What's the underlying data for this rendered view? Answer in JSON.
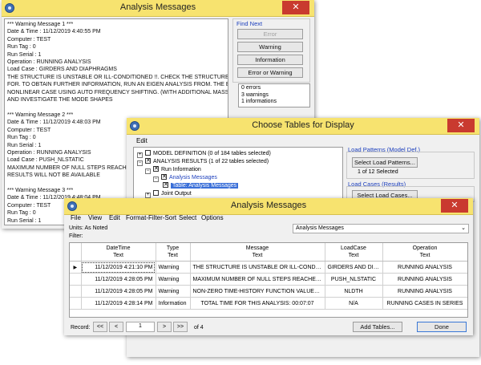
{
  "analysis_window": {
    "title": "Analysis Messages",
    "messages_text": "*** Warning Message 1 ***\nDate & Time : 11/12/2019 4:40:55 PM\nComputer : TEST\nRun Tag : 0\nRun Serial : 1\nOperation : RUNNING ANALYSIS\nLoad Case : GIRDERS AND DIAPHRAGMS\nTHE STRUCTURE IS UNSTABLE OR ILL-CONDITIONED !!. CHECK THE STRUCTURE CAREFULLY\nFOR. TO OBTAIN FURTHER INFORMATION, RUN AN EIGEN ANALYSIS FROM. THE END OF THIS\nNONLINEAR CASE USING AUTO FREQUENCY SHIFTING. (WITH ADDITIONAL MASS IF NEEDED)\nAND INVESTIGATE THE MODE SHAPES\n\n*** Warning Message 2 ***\nDate & Time : 11/12/2019 4:48:03 PM\nComputer : TEST\nRun Tag : 0\nRun Serial : 1\nOperation : RUNNING ANALYSIS\nLoad Case : PUSH_NLSTATIC\nMAXIMUM NUMBER OF NULL STEPS REACHED FOR. C\nRESULTS WILL NOT BE AVAILABLE\n\n*** Warning Message 3 ***\nDate & Time : 11/12/2019 4:48:04 PM\nComputer : TEST\nRun Tag : 0\nRun Serial : 1\nOperation : RUNNING ANALYSIS\nLoad Case : NLDTH\nNON-ZERO TIME-HISTOR\n\n*** Informational Messag",
    "find_next_label": "Find Next",
    "buttons": {
      "error": "Error",
      "warning": "Warning",
      "information": "Information",
      "error_or_warning": "Error or Warning"
    },
    "summary": {
      "errors": "0 errors",
      "warnings": "3 warnings",
      "informations": "1 informations"
    },
    "close_symbol": "✕"
  },
  "choose_window": {
    "title": "Choose Tables for Display",
    "menu_edit": "Edit",
    "tree": {
      "model_definition": "MODEL DEFINITION  (0 of 184 tables selected)",
      "analysis_results": "ANALYSIS RESULTS  (1 of 22 tables selected)",
      "run_information": "Run Information",
      "analysis_messages": "Analysis Messages",
      "table_analysis_messages": "Table:  Analysis Messages",
      "joint_output": "Joint Output"
    },
    "load_patterns_label": "Load Patterns (Model Def.)",
    "select_load_patterns": "Select Load Patterns...",
    "load_patterns_count": "1 of 12 Selected",
    "load_cases_label": "Load Cases (Results)",
    "select_load_cases": "Select Load Cases...",
    "close_symbol": "✕"
  },
  "table_window": {
    "title": "Analysis Messages",
    "menu": [
      "File",
      "View",
      "Edit",
      "Format-Filter-Sort",
      "Select",
      "Options"
    ],
    "units_label": "Units:  As Noted",
    "filter_label": "Filter:",
    "table_selector": "Analysis Messages",
    "columns": [
      {
        "title": "DateTime",
        "sub": "Text"
      },
      {
        "title": "Type",
        "sub": "Text"
      },
      {
        "title": "Message",
        "sub": "Text"
      },
      {
        "title": "LoadCase",
        "sub": "Text"
      },
      {
        "title": "Operation",
        "sub": "Text"
      }
    ],
    "rows": [
      [
        "11/12/2019 4:21:10 PM",
        "Warning",
        "THE STRUCTURE IS UNSTABLE OR ILL-CONDITIONED !...",
        "GIRDERS AND DIAPHRAGMS",
        "RUNNING ANALYSIS"
      ],
      [
        "11/12/2019 4:28:05 PM",
        "Warning",
        "MAXIMUM NUMBER OF NULL STEPS REACHED FOR. C...",
        "PUSH_NLSTATIC",
        "RUNNING ANALYSIS"
      ],
      [
        "11/12/2019 4:28:05 PM",
        "Warning",
        "NON-ZERO TIME-HISTORY FUNCTION VALUES WILL B...",
        "NLDTH",
        "RUNNING ANALYSIS"
      ],
      [
        "11/12/2019 4:28:14 PM",
        "Information",
        "TOTAL TIME FOR THIS ANALYSIS: 00:07:07",
        "N/A",
        "RUNNING CASES IN SERIES"
      ]
    ],
    "record_label": "Record:",
    "nav": {
      "first": "<<",
      "prev": "<",
      "current": "1",
      "next": ">",
      "last": ">>"
    },
    "of_label": "of 4",
    "add_tables": "Add Tables...",
    "done": "Done",
    "close_symbol": "✕"
  }
}
